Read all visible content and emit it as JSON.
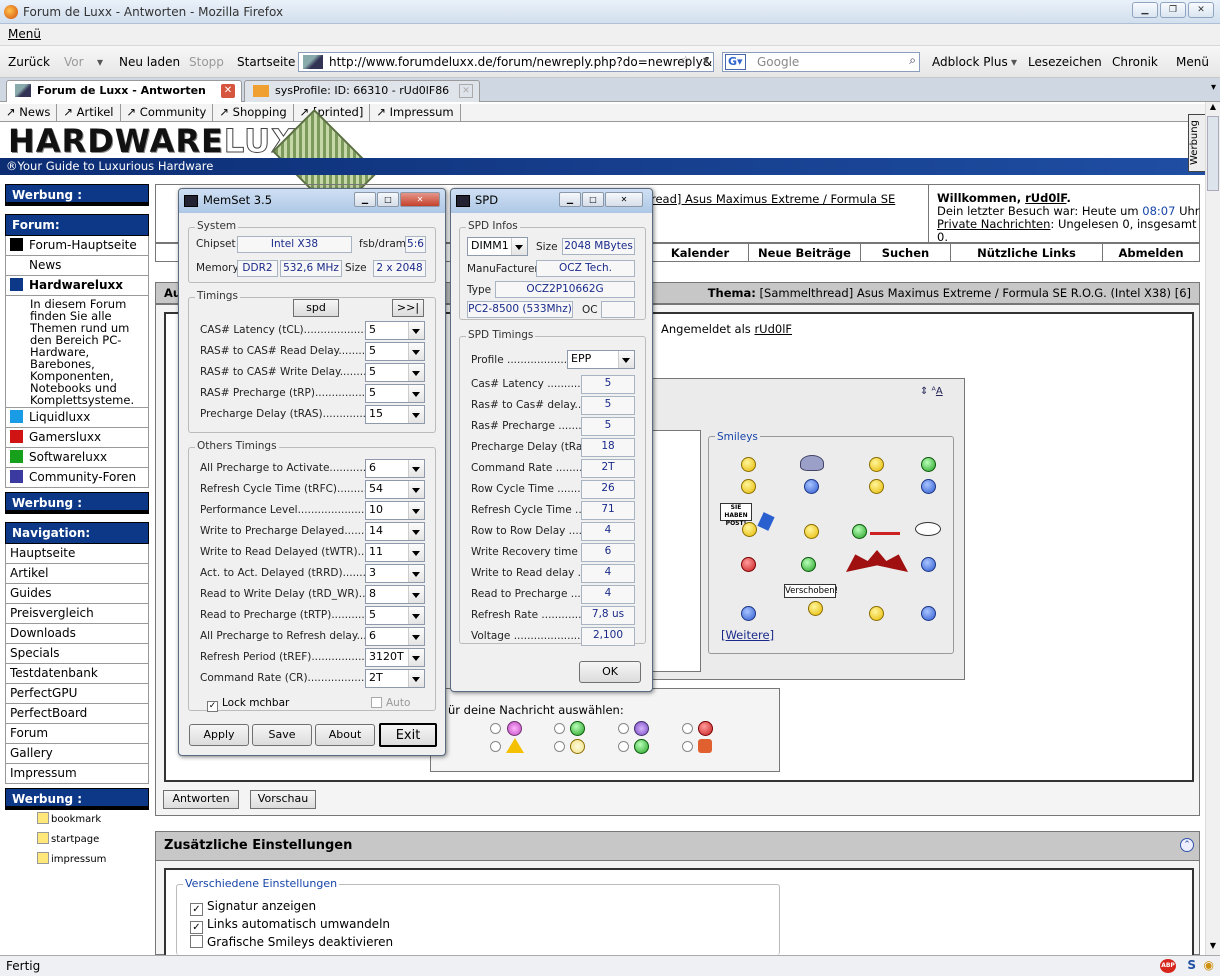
{
  "window": {
    "title": "Forum de Luxx - Antworten - Mozilla Firefox"
  },
  "menubar": {
    "menu": "Menü"
  },
  "toolbar": {
    "back": "Zurück",
    "forward": "Vor",
    "reload": "Neu laden",
    "stop": "Stopp",
    "home": "Startseite",
    "url": "http://www.forumdeluxx.de/forum/newreply.php?do=newreply&no",
    "search_placeholder": "Google",
    "adblock": "Adblock Plus",
    "bookmarks": "Lesezeichen",
    "history": "Chronik",
    "menu": "Menü"
  },
  "tabs": [
    {
      "label": "Forum de Luxx - Antworten"
    },
    {
      "label": "sysProfile: ID: 66310 - rUd0lF86"
    }
  ],
  "sitenav": [
    "News",
    "Artikel",
    "Community",
    "Shopping",
    "[printed]",
    "Impressum"
  ],
  "banner": {
    "logo_a": "HARDWARE",
    "logo_b": "LUXX",
    "tagline": "®Your Guide to Luxurious Hardware",
    "side": "Werbung"
  },
  "sidebar": {
    "werbung1": "Werbung :",
    "forum_head": "Forum:",
    "forum_items": [
      "Forum-Hauptseite",
      "News",
      "Hardwareluxx"
    ],
    "forum_desc": "In diesem Forum finden Sie alle Themen rund um den Bereich PC-Hardware, Barebones, Komponenten, Notebooks und Komplettsysteme.",
    "forum_items2": [
      "Liquidluxx",
      "Gamersluxx",
      "Softwareluxx",
      "Community-Foren"
    ],
    "werbung2": "Werbung :",
    "nav_head": "Navigation:",
    "nav_items": [
      "Hauptseite",
      "Artikel",
      "Guides",
      "Preisvergleich",
      "Downloads",
      "Specials",
      "Testdatenbank",
      "PerfectGPU",
      "PerfectBoard",
      "Forum",
      "Gallery",
      "Impressum"
    ],
    "werbung3": "Werbung :",
    "bookmarks": [
      "bookmark",
      "startpage",
      "impressum"
    ]
  },
  "header": {
    "thread_link": "read] Asus Maximus Extreme / Formula SE",
    "welcome": "Willkommen, ",
    "user": "rUd0lF",
    "last_visit": "Dein letzter Besuch war: Heute um ",
    "last_time": "08:07",
    "last_suffix": " Uhr",
    "pm": "Private Nachrichten",
    "pm_suffix": ": Ungelesen 0, insgesamt 0.",
    "nav": [
      "Kalender",
      "Neue Beiträge",
      "Suchen",
      "Nützliche Links",
      "Abmelden"
    ],
    "thema_label": "Thema:",
    "thema": " [Sammelthread] Asus Maximus Extreme / Formula SE R.O.G. (Intel X38) [6]",
    "logged_in": "Angemeldet als ",
    "au": "Au"
  },
  "smileys": {
    "label": "Smileys",
    "more": "[Weitere]",
    "sign1": "SIE HABEN POST!",
    "sign2": "Verschoben!"
  },
  "icons_row": {
    "label": "ür deine Nachricht auswählen:"
  },
  "buttons": {
    "reply": "Antworten",
    "preview": "Vorschau"
  },
  "settings": {
    "title": "Zusätzliche Einstellungen",
    "group": "Verschiedene Einstellungen",
    "opts": [
      "Signatur anzeigen",
      "Links automatisch umwandeln",
      "Grafische Smileys deaktivieren"
    ]
  },
  "memset": {
    "title": "MemSet 3.5",
    "system_label": "System",
    "chipset_label": "Chipset",
    "chipset": "Intel X38",
    "fsb_label": "fsb/dram",
    "fsb": "5:6",
    "memory_label": "Memory",
    "mem_type": "DDR2",
    "mem_speed": "532,6 MHz",
    "size_label": "Size",
    "size": "2 x 2048",
    "timings_label": "Timings",
    "spd_btn": "spd",
    "more_btn": ">>|",
    "timings": [
      {
        "label": "CAS# Latency (tCL)........................",
        "value": "5"
      },
      {
        "label": "RAS# to CAS# Read Delay............",
        "value": "5"
      },
      {
        "label": "RAS# to CAS# Write Delay...........",
        "value": "5"
      },
      {
        "label": "RAS# Precharge (tRP)....................",
        "value": "5"
      },
      {
        "label": "Precharge Delay  (tRAS)..................",
        "value": "15"
      }
    ],
    "others_label": "Others Timings",
    "others": [
      {
        "label": "All Precharge to Activate..................",
        "value": "6"
      },
      {
        "label": "Refresh Cycle Time (tRFC)..............",
        "value": "54"
      },
      {
        "label": "Performance Level...........................",
        "value": "10"
      },
      {
        "label": "Write to Precharge Delayed.............",
        "value": "14"
      },
      {
        "label": "Write to Read Delayed (tWTR)........",
        "value": "11"
      },
      {
        "label": "Act. to Act. Delayed (tRRD)............",
        "value": "3"
      },
      {
        "label": "Read to Write Delay (tRD_WR).......",
        "value": "8"
      },
      {
        "label": "Read to Precharge (tRTP)...............",
        "value": "5"
      },
      {
        "label": "All Precharge to Refresh delay.........",
        "value": "6"
      },
      {
        "label": "Refresh Period (tREF).....................",
        "value": "3120T"
      },
      {
        "label": "Command Rate (CR).......................",
        "value": "2T"
      }
    ],
    "lock": "Lock mchbar",
    "auto": "Auto",
    "apply": "Apply",
    "save": "Save",
    "about": "About",
    "exit": "Exit"
  },
  "spd": {
    "title": "SPD",
    "infos_label": "SPD Infos",
    "dimm": "DIMM1",
    "size_label": "Size",
    "size": "2048 MBytes",
    "manu_label": "ManuFacturer",
    "manu": "OCZ Tech.",
    "type_label": "Type",
    "type": "OCZ2P10662G",
    "speed": "PC2-8500 (533Mhz)",
    "oc_label": "OC",
    "timings_label": "SPD Timings",
    "profile_label": "Profile ........................",
    "profile": "EPP",
    "rows": [
      {
        "label": "Cas# Latency ..............",
        "value": "5"
      },
      {
        "label": "Ras# to Cas# delay.......",
        "value": "5"
      },
      {
        "label": "Ras# Precharge ...........",
        "value": "5"
      },
      {
        "label": "Precharge Delay (tRas).",
        "value": "18"
      },
      {
        "label": "Command Rate ............",
        "value": "2T"
      },
      {
        "label": "Row Cycle Time ...........",
        "value": "26"
      },
      {
        "label": "Refresh Cycle Time .......",
        "value": "71"
      },
      {
        "label": "Row to Row Delay .......",
        "value": "4"
      },
      {
        "label": "Write Recovery time .....",
        "value": "6"
      },
      {
        "label": "Write to Read delay .....",
        "value": "4"
      },
      {
        "label": "Read to Precharge .......",
        "value": "4"
      },
      {
        "label": "Refresh Rate ...............",
        "value": "7,8 us"
      },
      {
        "label": "Voltage ........................",
        "value": "2,100"
      }
    ],
    "ok": "OK"
  },
  "status": {
    "text": "Fertig"
  }
}
